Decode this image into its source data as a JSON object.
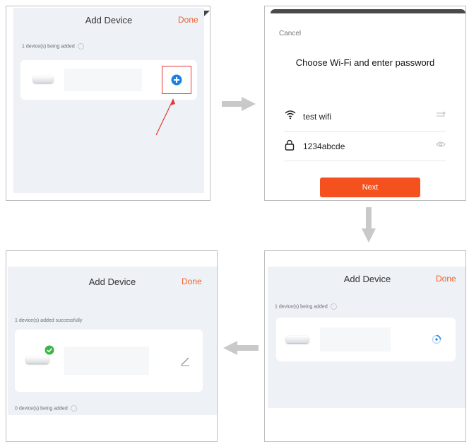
{
  "step1": {
    "title": "Add Device",
    "done": "Done",
    "status": "1 device(s) being added",
    "colors": {
      "accent": "#f0622f",
      "add_button": "#1e7fe0",
      "highlight_box": "#e53935"
    }
  },
  "step2": {
    "cancel": "Cancel",
    "heading": "Choose Wi-Fi and enter password",
    "wifi_name": "test wifi",
    "password": "1234abcde",
    "next": "Next",
    "colors": {
      "next_button": "#f4511e"
    }
  },
  "step3": {
    "title": "Add Device",
    "done": "Done",
    "status": "1 device(s) being added"
  },
  "step4": {
    "title": "Add Device",
    "done": "Done",
    "status_success": "1 device(s) added successfully",
    "status_adding": "0 device(s) being added",
    "colors": {
      "check": "#3bb54a"
    }
  },
  "icons": [
    "add-circle-icon",
    "wifi-icon",
    "switch-network-icon",
    "lock-icon",
    "eye-icon",
    "edit-icon",
    "check-icon",
    "arrow-right-icon",
    "arrow-down-icon",
    "arrow-left-icon"
  ]
}
